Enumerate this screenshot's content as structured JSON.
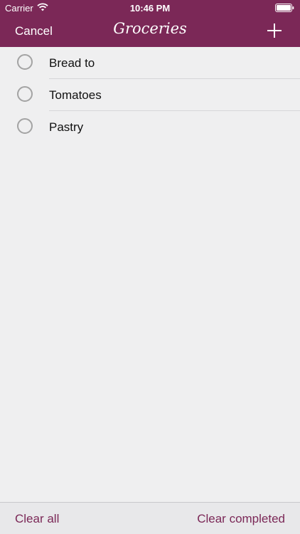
{
  "status_bar": {
    "carrier": "Carrier",
    "time": "10:46 PM",
    "wifi_icon": "wifi-icon",
    "battery_icon": "battery-icon"
  },
  "nav_bar": {
    "cancel_label": "Cancel",
    "title": "Groceries",
    "add_icon": "plus-icon"
  },
  "items": [
    {
      "label": "Bread to",
      "completed": false
    },
    {
      "label": "Tomatoes",
      "completed": false
    },
    {
      "label": "Pastry",
      "completed": false
    }
  ],
  "bottom_bar": {
    "clear_all_label": "Clear all",
    "clear_completed_label": "Clear completed"
  },
  "colors": {
    "accent": "#7b2857",
    "background": "#efeff0",
    "checkbox_border": "#a3a3a3"
  }
}
